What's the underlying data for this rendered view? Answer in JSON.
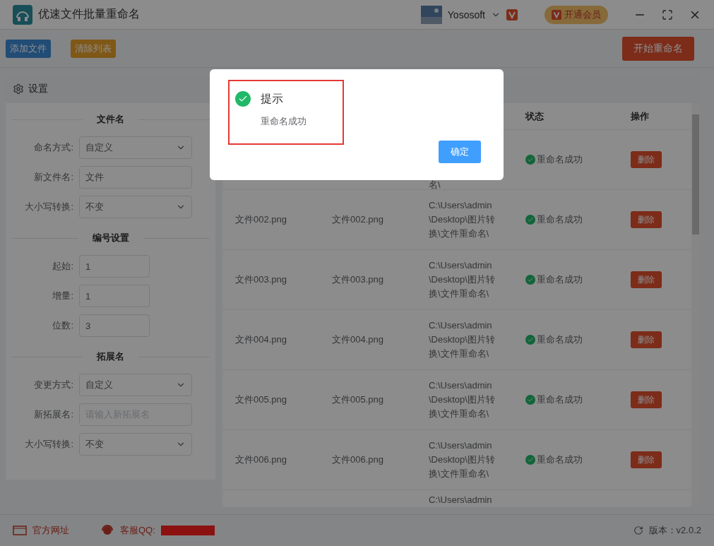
{
  "window": {
    "title": "优速文件批量重命名",
    "user": "Yososoft",
    "vip_button": "开通会员"
  },
  "toolbar": {
    "buttons": [
      {
        "label": "添加文件",
        "kind": "blue"
      },
      {
        "label": "清除列表",
        "kind": "orange"
      }
    ],
    "start_button": "开始重命名"
  },
  "settings": {
    "title": "设置",
    "sections": [
      {
        "heading": "文件名",
        "fields": [
          {
            "label": "命名方式:",
            "kind": "select",
            "value": "自定义"
          },
          {
            "label": "新文件名:",
            "kind": "input",
            "value": "文件"
          },
          {
            "label": "大小写转换:",
            "kind": "select",
            "value": "不变"
          }
        ]
      },
      {
        "heading": "编号设置",
        "fields": [
          {
            "label": "起始:",
            "kind": "short",
            "value": "1"
          },
          {
            "label": "增量:",
            "kind": "short",
            "value": "1"
          },
          {
            "label": "位数:",
            "kind": "short",
            "value": "3"
          }
        ]
      },
      {
        "heading": "拓展名",
        "fields": [
          {
            "label": "变更方式:",
            "kind": "select",
            "value": "自定义"
          },
          {
            "label": "新拓展名:",
            "kind": "input",
            "placeholder": "请输入新拓展名"
          },
          {
            "label": "大小写转换:",
            "kind": "select",
            "value": "不变"
          }
        ]
      }
    ]
  },
  "table": {
    "columns": [
      "状态",
      "操作"
    ],
    "rows": [
      {
        "path": "名\\",
        "status": "重命名成功",
        "action": "删除"
      },
      {
        "name": "文件002.png",
        "new_name": "文件002.png",
        "path": "C:\\Users\\admin\\Desktop\\图片转换\\文件重命名\\",
        "status": "重命名成功",
        "action": "删除"
      },
      {
        "name": "文件003.png",
        "new_name": "文件003.png",
        "path": "C:\\Users\\admin\\Desktop\\图片转换\\文件重命名\\",
        "status": "重命名成功",
        "action": "删除"
      },
      {
        "name": "文件004.png",
        "new_name": "文件004.png",
        "path": "C:\\Users\\admin\\Desktop\\图片转换\\文件重命名\\",
        "status": "重命名成功",
        "action": "删除"
      },
      {
        "name": "文件005.png",
        "new_name": "文件005.png",
        "path": "C:\\Users\\admin\\Desktop\\图片转换\\文件重命名\\",
        "status": "重命名成功",
        "action": "删除"
      },
      {
        "name": "文件006.png",
        "new_name": "文件006.png",
        "path": "C:\\Users\\admin\\Desktop\\图片转换\\文件重命名\\",
        "status": "重命名成功",
        "action": "删除"
      },
      {
        "path": "C:\\Users\\admin"
      }
    ]
  },
  "footer": {
    "website": "官方网址",
    "support": "客服QQ:",
    "version": "版本：v2.0.2"
  },
  "dialog": {
    "title": "提示",
    "message": "重命名成功",
    "ok_button": "确定"
  }
}
